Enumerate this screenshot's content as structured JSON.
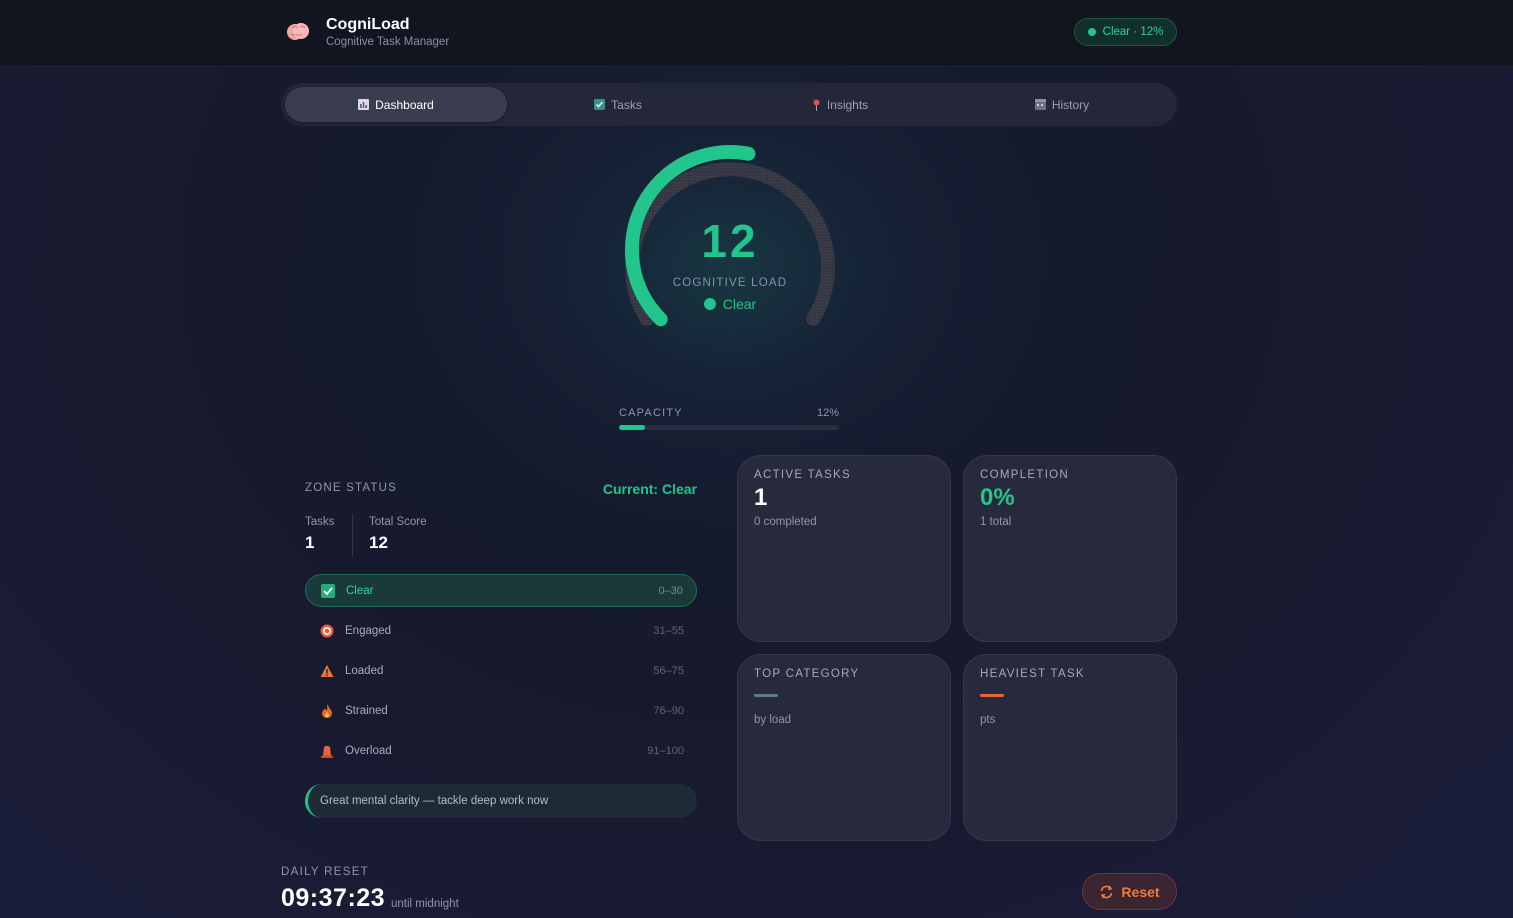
{
  "header": {
    "app_name": "CogniLoad",
    "subtitle": "Cognitive Task Manager",
    "status_pill": "Clear · 12%"
  },
  "tabs": [
    {
      "label": "Dashboard",
      "icon": "chart-icon",
      "active": true
    },
    {
      "label": "Tasks",
      "icon": "checkbox-icon",
      "active": false
    },
    {
      "label": "Insights",
      "icon": "pin-icon",
      "active": false
    },
    {
      "label": "History",
      "icon": "calendar-icon",
      "active": false
    }
  ],
  "gauge": {
    "value": "12",
    "label": "COGNITIVE LOAD",
    "zone": "Clear",
    "fraction": 0.12,
    "accent": "#22c58b"
  },
  "capacity": {
    "label": "CAPACITY",
    "percent_text": "12%",
    "percent": 12
  },
  "zone_status": {
    "title": "ZONE STATUS",
    "current": "Current: Clear",
    "tasks_label": "Tasks",
    "tasks_value": "1",
    "score_label": "Total Score",
    "score_value": "12",
    "zones": [
      {
        "name": "Clear",
        "range": "0–30",
        "icon": "check-icon",
        "active": true
      },
      {
        "name": "Engaged",
        "range": "31–55",
        "icon": "target-icon",
        "active": false
      },
      {
        "name": "Loaded",
        "range": "56–75",
        "icon": "warning-icon",
        "active": false
      },
      {
        "name": "Strained",
        "range": "76–90",
        "icon": "fire-icon",
        "active": false
      },
      {
        "name": "Overload",
        "range": "91–100",
        "icon": "alarm-icon",
        "active": false
      }
    ],
    "tip": "Great mental clarity — tackle deep work now"
  },
  "cards": {
    "active_tasks": {
      "title": "ACTIVE TASKS",
      "value": "1",
      "sub": "0 completed"
    },
    "completion": {
      "title": "COMPLETION",
      "value": "0%",
      "sub": "1 total"
    },
    "top_category": {
      "title": "TOP CATEGORY",
      "sub": "by load",
      "bar_color": "#5e7a8a"
    },
    "heaviest_task": {
      "title": "HEAVIEST TASK",
      "sub": "pts",
      "bar_color": "#e8653a"
    }
  },
  "reset": {
    "label": "DAILY RESET",
    "time": "09:37:23",
    "until": "until midnight",
    "button": "Reset"
  }
}
